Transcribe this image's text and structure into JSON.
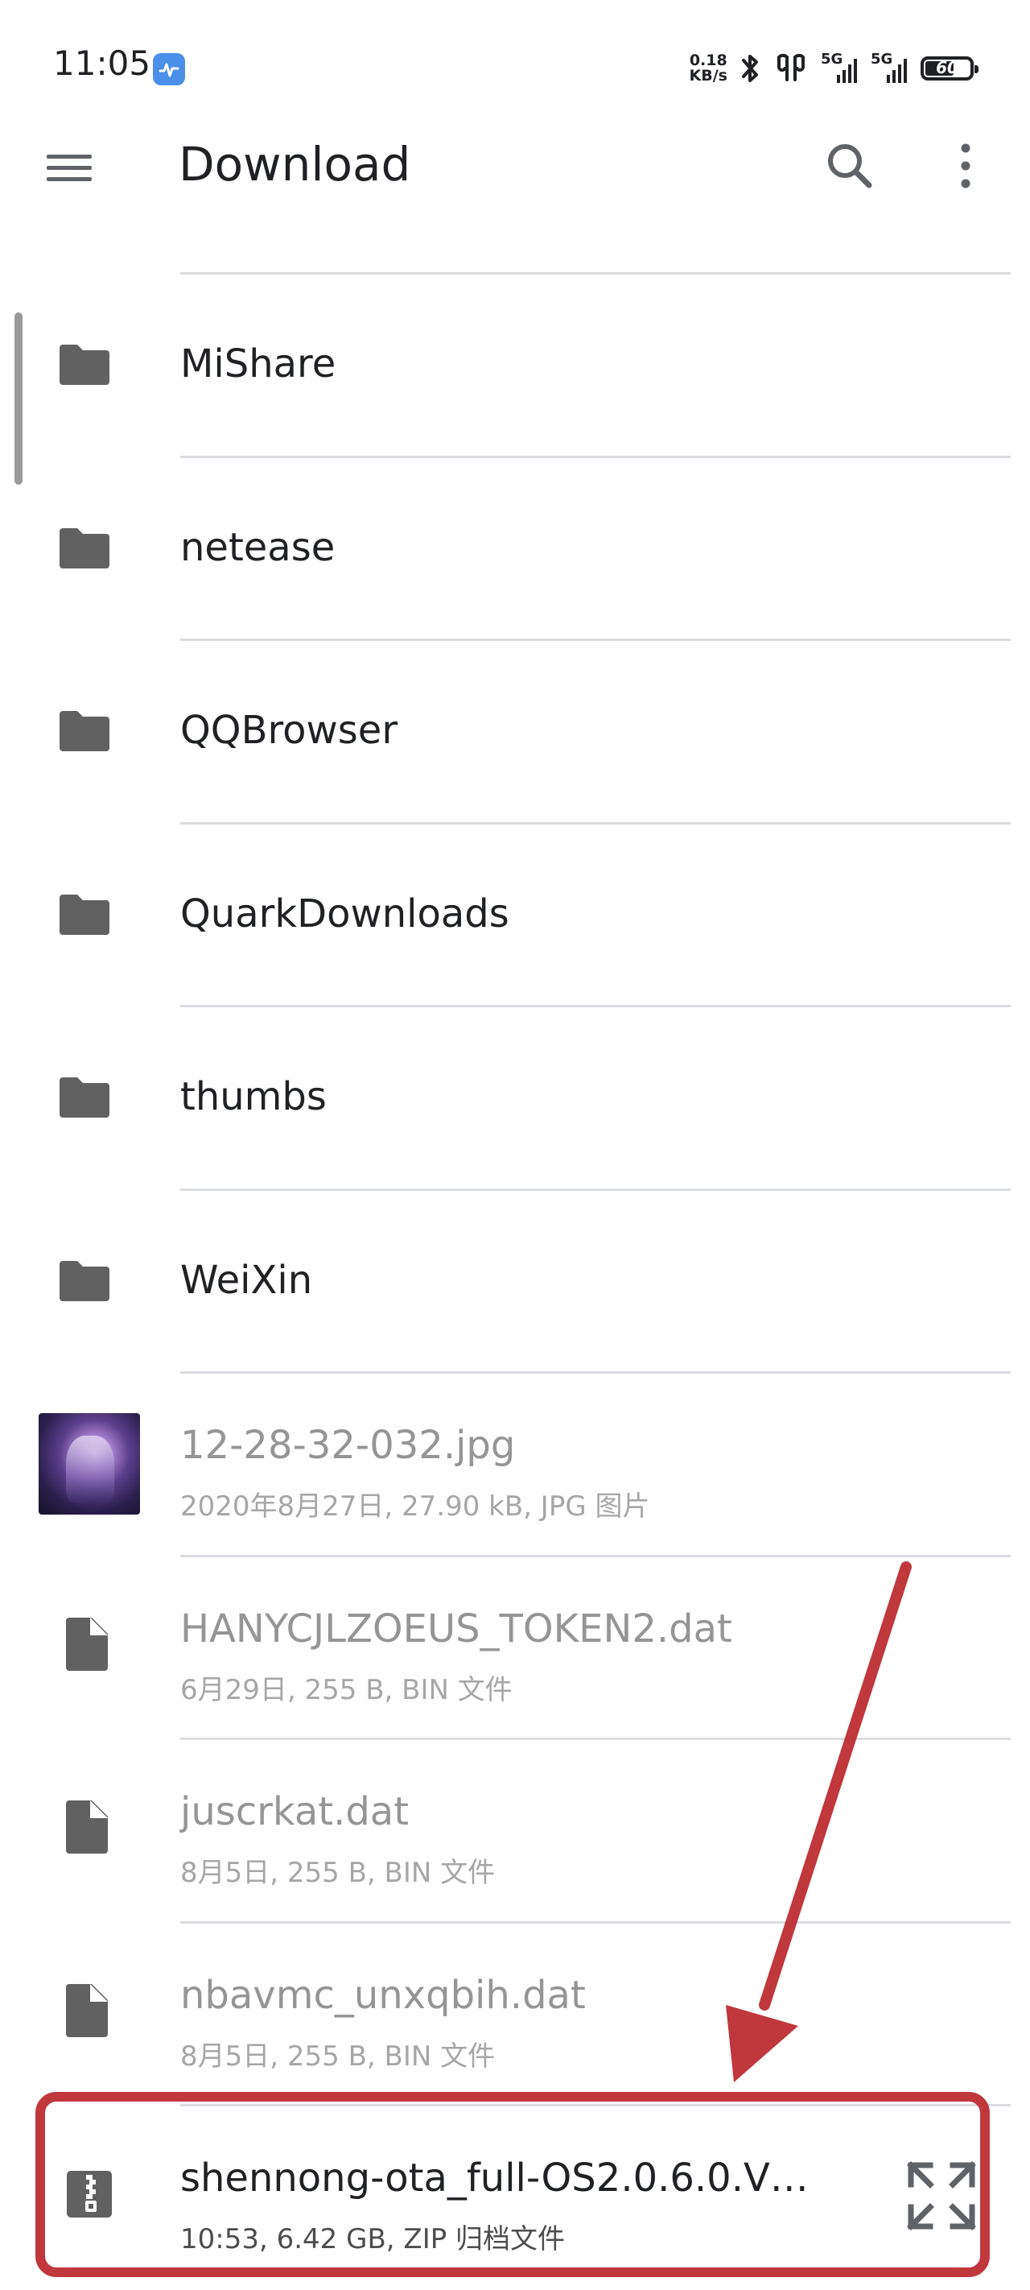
{
  "status_bar": {
    "time": "11:05",
    "net_speed_value": "0.18",
    "net_speed_unit": "KB/s",
    "signal1_label": "5G",
    "signal2_label": "5G",
    "battery": "60"
  },
  "app_bar": {
    "title": "Download",
    "menu_icon": "hamburger-menu-icon",
    "search_icon": "search-icon",
    "more_icon": "more-vert-icon"
  },
  "folders": [
    {
      "name": "MiShare"
    },
    {
      "name": "netease"
    },
    {
      "name": "QQBrowser"
    },
    {
      "name": "QuarkDownloads"
    },
    {
      "name": "thumbs"
    },
    {
      "name": "WeiXin"
    }
  ],
  "files": [
    {
      "name": "12-28-32-032.jpg",
      "details": "2020年8月27日, 27.90 kB, JPG 图片",
      "icon": "image-thumbnail"
    },
    {
      "name": "HANYCJLZOEUS_TOKEN2.dat",
      "details": "6月29日, 255 B, BIN 文件",
      "icon": "file-icon"
    },
    {
      "name": "juscrkat.dat",
      "details": "8月5日, 255 B, BIN 文件",
      "icon": "file-icon"
    },
    {
      "name": "nbavmc_unxqbih.dat",
      "details": "8月5日, 255 B, BIN 文件",
      "icon": "file-icon"
    }
  ],
  "highlighted_file": {
    "name": "shennong-ota_full-OS2.0.6.0.V…",
    "details": "10:53, 6.42 GB, ZIP 归档文件",
    "icon": "zip-archive-icon",
    "action_icon": "expand-archive-icon"
  },
  "colors": {
    "annotation": "#c0373c",
    "icon_gray": "#616161",
    "divider": "#dadce0",
    "dimmed_text": "#959595"
  }
}
